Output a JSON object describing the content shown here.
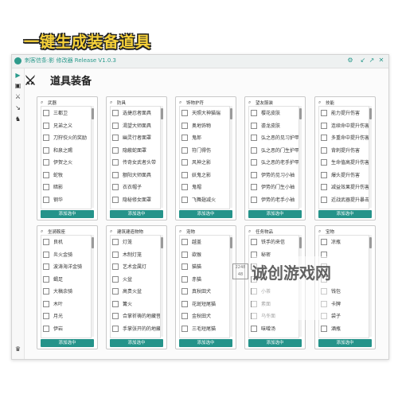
{
  "banner": "一键生成装备道具",
  "window": {
    "title": "刺客信条:影 修改器 Release V1.0.3"
  },
  "section": {
    "title": "道具装备"
  },
  "panels": [
    {
      "title": "武器",
      "items": [
        "三都卫",
        "兄弟之义",
        "刀狩佼火的奖励",
        "和泉之赐",
        "伊贺之火",
        "蛇牧",
        "暗影",
        "钢华",
        "血影"
      ],
      "button": "添加选中"
    },
    {
      "title": "防具",
      "items": [
        "选捷忍者面具",
        "渴望大师面具",
        "幽灵行者面罩",
        "隐蔽蛇面罩",
        "传奇女武者头带",
        "额阳大师面具",
        "衣衣帽子",
        "隐秘修女面罩",
        "部灵修面面具"
      ],
      "button": "添加选中"
    },
    {
      "title": "饰物护符",
      "items": [
        "天照大神猫瑞",
        "奥地饰物",
        "鬼郎",
        "符门得伤",
        "风神之影",
        "妖鬼之影",
        "鬼帽",
        "飞舞翅减火",
        "龙吟"
      ],
      "button": "添加选中"
    },
    {
      "title": "望友服装",
      "items": [
        "樱花皮肤",
        "鎏龙皮肤",
        "弘之恶的见习护甲",
        "弘之恶的门生护甲",
        "弘之恶的老手护甲",
        "伊势的见习小袖",
        "伊势的门生小袖",
        "伊势的老手小袖",
        "胜艇的见习小袖"
      ],
      "button": "添加选中"
    },
    {
      "title": "技能",
      "items": [
        "能力提升伤害",
        "连续命中提升伤害",
        "多重命中提升伤害",
        "背刺提升伤害",
        "生命值高提升伤害",
        "爆头提升伤害",
        "减益效果提升伤害",
        "近战武器提升暴击伤害",
        "敌人生命过半提升伤"
      ],
      "button": "添加选中"
    },
    {
      "title": "坐骑鞍座",
      "items": [
        "良机",
        "炎火金骑",
        "波涛海洋金骑",
        "蝎足",
        "大稿余骑",
        "木叶",
        "月光",
        "伊岩",
        "通路"
      ],
      "button": "添加选中"
    },
    {
      "title": "建筑建造物物",
      "items": [
        "灯笼",
        "木制灯笼",
        "艺术金属灯",
        "火盆",
        "高贵火盆",
        "篝火",
        "合掌祈祷的地藏菩萨",
        "手掌张开的的地藏菩萨",
        "鹿然地藏菩萨像"
      ],
      "button": "添加选中"
    },
    {
      "title": "宠物",
      "items": [
        "越盖",
        "欲猴",
        "猫猫",
        "赤猫",
        "真秋田犬",
        "花斑短尾猫",
        "金秋田犬",
        "三毛短尾猫",
        "三毛短尾短猫"
      ],
      "button": "添加选中"
    },
    {
      "title": "任务物品",
      "items": [
        "铁手的来信",
        "秘密",
        "",
        "",
        "小茶",
        "素面",
        "乌冬面",
        "味噌汤",
        ""
      ],
      "button": "添加选中"
    },
    {
      "title": "宝物",
      "items": [
        "凉瓶",
        "",
        "",
        "",
        "钱包",
        "卡牌",
        "袋子",
        "酒瓶",
        ""
      ],
      "button": "添加选中"
    }
  ],
  "watermark": {
    "text": "诚创游戏网",
    "logo": "2248 48"
  }
}
